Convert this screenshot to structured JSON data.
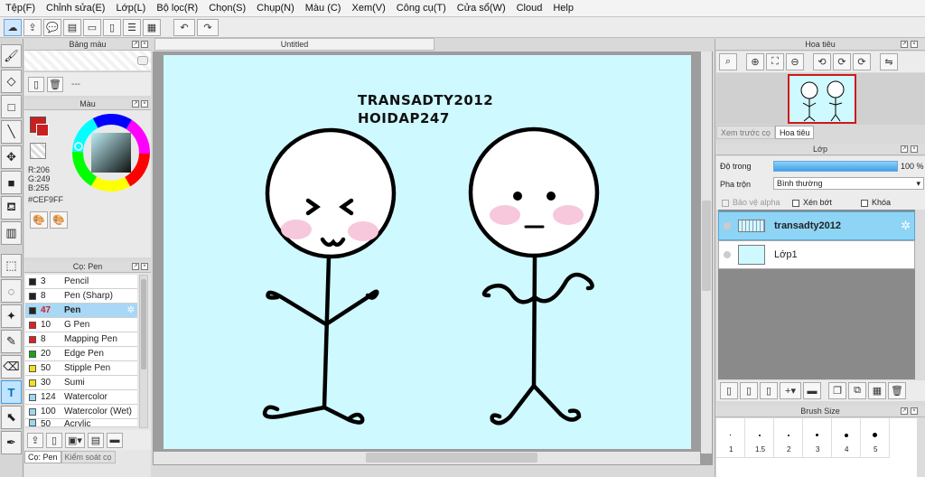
{
  "menu": [
    "Tệp(F)",
    "Chỉnh sửa(E)",
    "Lớp(L)",
    "Bộ lọc(R)",
    "Chọn(S)",
    "Chụp(N)",
    "Màu (C)",
    "Xem(V)",
    "Công cụ(T)",
    "Cửa sổ(W)",
    "Cloud",
    "Help"
  ],
  "palette_panel": {
    "title": "Bảng màu",
    "placeholder": "---"
  },
  "color_panel": {
    "title": "Màu",
    "r": "R:206",
    "g": "G:249",
    "b": "B:255",
    "hex": "#CEF9FF",
    "main_color": "#c82020"
  },
  "brush_panel": {
    "title": "Cọ: Pen",
    "items": [
      {
        "size": "3",
        "name": "Pencil",
        "color": "#222222"
      },
      {
        "size": "8",
        "name": "Pen (Sharp)",
        "color": "#222222"
      },
      {
        "size": "47",
        "name": "Pen",
        "color": "#222222"
      },
      {
        "size": "10",
        "name": "G Pen",
        "color": "#e02020"
      },
      {
        "size": "8",
        "name": "Mapping Pen",
        "color": "#e02020"
      },
      {
        "size": "20",
        "name": "Edge Pen",
        "color": "#20a020"
      },
      {
        "size": "50",
        "name": "Stipple Pen",
        "color": "#f0e020"
      },
      {
        "size": "30",
        "name": "Sumi",
        "color": "#f0e020"
      },
      {
        "size": "124",
        "name": "Watercolor",
        "color": "#9ad8f0"
      },
      {
        "size": "100",
        "name": "Watercolor (Wet)",
        "color": "#9ad8f0"
      },
      {
        "size": "50",
        "name": "Acrylic",
        "color": "#9ad8f0"
      }
    ],
    "bottom_tabs": [
      "Cọ: Pen",
      "Kiểm soát cọ"
    ]
  },
  "document": {
    "tab": "Untitled",
    "canvas_text_line1": "TRANSADTY2012",
    "canvas_text_line2": "HOIDAP247"
  },
  "navigator": {
    "title": "Hoa tiêu",
    "tabs": [
      "Xem trước cọ",
      "Hoa tiêu"
    ]
  },
  "layers": {
    "title": "Lớp",
    "opacity_label": "Độ trong",
    "opacity_value": "100 %",
    "blend_label": "Pha trộn",
    "blend_value": "Bình thường",
    "protect_alpha": "Bảo vệ alpha",
    "clipping": "Xén bớt",
    "lock": "Khóa",
    "items": [
      {
        "name": "transadty2012",
        "selected": true
      },
      {
        "name": "Lớp1",
        "selected": false
      }
    ]
  },
  "brush_size": {
    "title": "Brush Size",
    "values": [
      "1",
      "1.5",
      "2",
      "3",
      "4",
      "5"
    ]
  }
}
